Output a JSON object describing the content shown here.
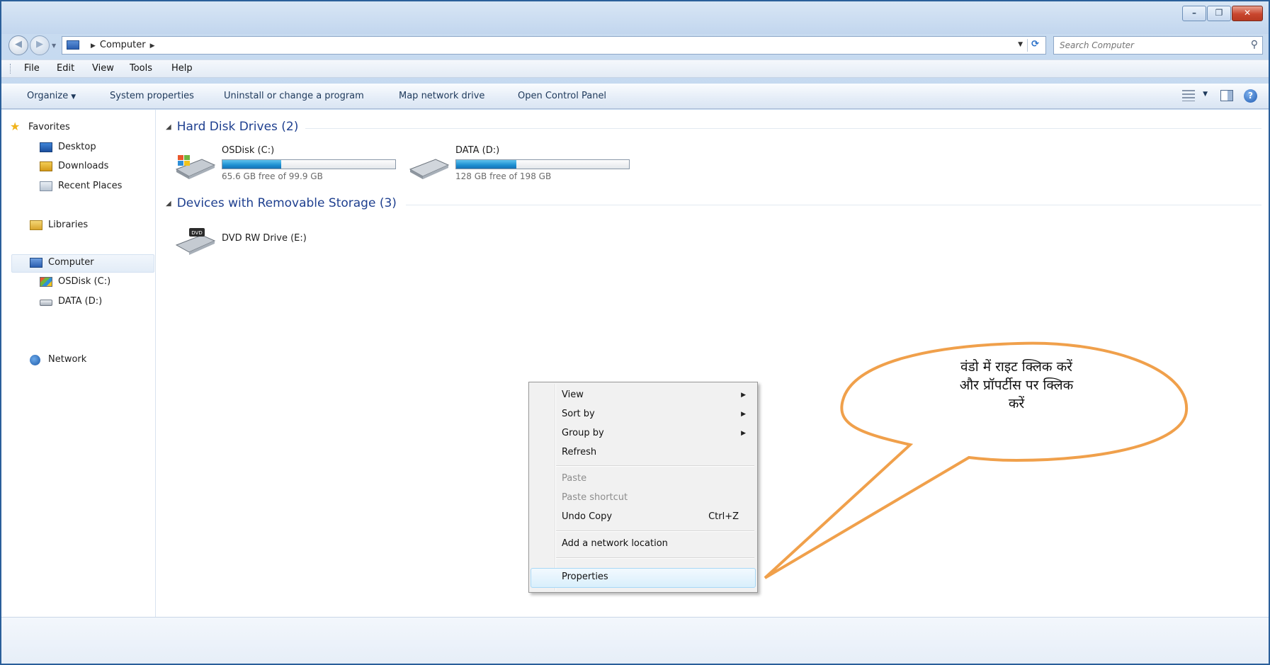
{
  "window": {
    "caption_minimize": "–",
    "caption_maximize": "❐",
    "caption_close": "✕"
  },
  "address": {
    "crumb": "Computer",
    "search_placeholder": "Search Computer"
  },
  "menubar": [
    "File",
    "Edit",
    "View",
    "Tools",
    "Help"
  ],
  "toolbar": {
    "organize": "Organize",
    "system_properties": "System properties",
    "uninstall": "Uninstall or change a program",
    "map_drive": "Map network drive",
    "control_panel": "Open Control Panel"
  },
  "navpane": {
    "favorites": "Favorites",
    "desktop": "Desktop",
    "downloads": "Downloads",
    "recent": "Recent Places",
    "libraries": "Libraries",
    "computer": "Computer",
    "osdisk": "OSDisk (C:)",
    "data": "DATA (D:)",
    "network": "Network"
  },
  "groups": {
    "hdd": "Hard Disk Drives (2)",
    "removable": "Devices with Removable Storage (3)"
  },
  "drives": {
    "c": {
      "name": "OSDisk (C:)",
      "free": "65.6 GB free of 99.9 GB",
      "used_fraction": 0.34
    },
    "d": {
      "name": "DATA (D:)",
      "free": "128 GB free of 198 GB",
      "used_fraction": 0.35
    },
    "e": {
      "name": "DVD RW Drive (E:)",
      "label": "DVD"
    }
  },
  "context_menu": {
    "view": "View",
    "sort_by": "Sort by",
    "group_by": "Group by",
    "refresh": "Refresh",
    "paste": "Paste",
    "paste_shortcut": "Paste shortcut",
    "undo_copy": "Undo Copy",
    "undo_shortcut": "Ctrl+Z",
    "add_network": "Add a network location",
    "properties": "Properties"
  },
  "callout": {
    "line1": "वंडो में राइट क्लिक करें",
    "line2": "और प्रॉपर्टीस पर क्लिक",
    "line3": "करें"
  },
  "colors": {
    "accent": "#1e3f8f",
    "callout_border": "#f0a04b",
    "frame": "#2a5f9a"
  }
}
